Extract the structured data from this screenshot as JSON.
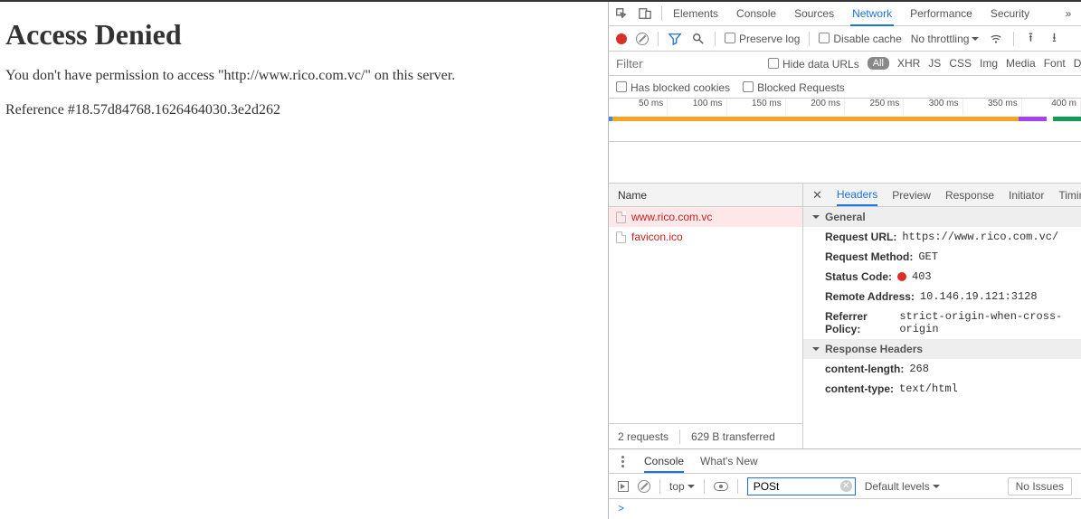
{
  "page": {
    "title": "Access Denied",
    "message": "You don't have permission to access \"http://www.rico.com.vc/\" on this server.",
    "reference": "Reference #18.57d84768.1626464030.3e2d262"
  },
  "devtools": {
    "main_tabs": {
      "t0": "Elements",
      "t1": "Console",
      "t2": "Sources",
      "t3": "Network",
      "t4": "Performance",
      "t5": "Security"
    },
    "net_toolbar": {
      "preserve": "Preserve log",
      "disable": "Disable cache",
      "throttle": "No throttling"
    },
    "filter": {
      "placeholder": "Filter",
      "hide_urls": "Hide data URLs",
      "types": {
        "all": "All",
        "xhr": "XHR",
        "js": "JS",
        "css": "CSS",
        "img": "Img",
        "media": "Media",
        "font": "Font",
        "doc": "Do"
      },
      "blocked_cookies": "Has blocked cookies",
      "blocked_req": "Blocked Requests"
    },
    "timeline": {
      "ticks": [
        "50 ms",
        "100 ms",
        "150 ms",
        "200 ms",
        "250 ms",
        "300 ms",
        "350 ms",
        "400 m"
      ]
    },
    "requests": {
      "head": "Name",
      "rows": [
        {
          "name": "www.rico.com.vc",
          "selected": true
        },
        {
          "name": "favicon.ico",
          "selected": false
        }
      ],
      "status_count": "2 requests",
      "status_size": "629 B transferred"
    },
    "details": {
      "tabs": {
        "headers": "Headers",
        "preview": "Preview",
        "response": "Response",
        "initiator": "Initiator",
        "timing": "Timing"
      },
      "general": {
        "title": "General",
        "url_l": "Request URL:",
        "url_v": "https://www.rico.com.vc/",
        "method_l": "Request Method:",
        "method_v": "GET",
        "status_l": "Status Code:",
        "status_v": "403",
        "remote_l": "Remote Address:",
        "remote_v": "10.146.19.121:3128",
        "ref_l": "Referrer Policy:",
        "ref_v": "strict-origin-when-cross-origin"
      },
      "resp": {
        "title": "Response Headers",
        "cl_l": "content-length:",
        "cl_v": "268",
        "ct_l": "content-type:",
        "ct_v": "text/html"
      }
    },
    "drawer": {
      "tabs": {
        "console": "Console",
        "whats_new": "What's New"
      },
      "context": "top",
      "filter_value": "POSt",
      "levels": "Default levels",
      "issues": "No Issues",
      "prompt": ">"
    }
  }
}
